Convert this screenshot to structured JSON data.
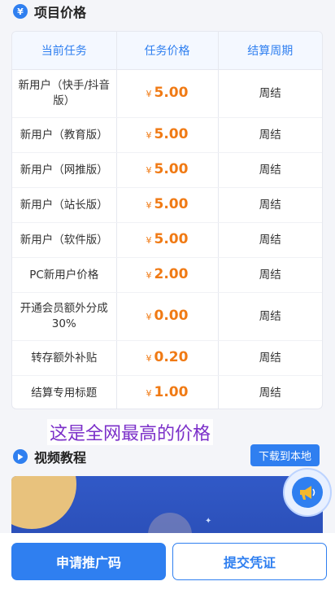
{
  "price_section": {
    "icon": "yen-icon",
    "title": "项目价格"
  },
  "table": {
    "headers": [
      "当前任务",
      "任务价格",
      "结算周期"
    ],
    "currency_symbol": "¥",
    "rows": [
      {
        "task": "新用户（快手/抖音版）",
        "price": "5.00",
        "cycle": "周结"
      },
      {
        "task": "新用户（教育版）",
        "price": "5.00",
        "cycle": "周结"
      },
      {
        "task": "新用户（网推版）",
        "price": "5.00",
        "cycle": "周结"
      },
      {
        "task": "新用户（站长版）",
        "price": "5.00",
        "cycle": "周结"
      },
      {
        "task": "新用户（软件版）",
        "price": "5.00",
        "cycle": "周结"
      },
      {
        "task": "PC新用户价格",
        "price": "2.00",
        "cycle": "周结"
      },
      {
        "task": "开通会员额外分成30%",
        "price": "0.00",
        "cycle": "周结"
      },
      {
        "task": "转存额外补贴",
        "price": "0.20",
        "cycle": "周结"
      },
      {
        "task": "结算专用标题",
        "price": "1.00",
        "cycle": "周结"
      }
    ]
  },
  "caption": "这是全网最高的价格",
  "video_section": {
    "icon": "play-icon",
    "title": "视频教程",
    "download_label": "下载到本地"
  },
  "bottom_actions": {
    "apply_label": "申请推广码",
    "submit_label": "提交凭证"
  },
  "colors": {
    "accent": "#2f7ff0",
    "price": "#f07a14",
    "caption": "#7b2fc9"
  }
}
